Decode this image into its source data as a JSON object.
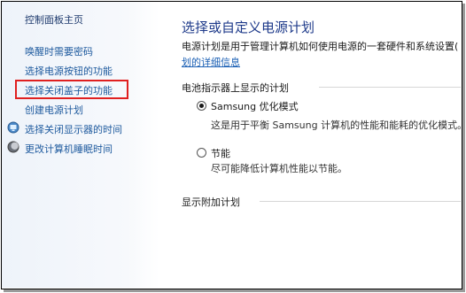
{
  "sidebar": {
    "home": "控制面板主页",
    "tasks": [
      "唤醒时需要密码",
      "选择电源按钮的功能",
      "选择关闭盖子的功能",
      "创建电源计划"
    ],
    "icon_tasks": [
      {
        "label": "选择关闭显示器的时间",
        "icon": "monitor-icon"
      },
      {
        "label": "更改计算机睡眠时间",
        "icon": "moon-icon"
      }
    ],
    "highlight_color": "#e02020"
  },
  "main": {
    "title": "选择或自定义电源计划",
    "description": "电源计划是用于管理计算机如何使用电源的一套硬件和系统设置(",
    "link_fragment": "划的详细信息",
    "battery_group": {
      "title": "电池指示器上显示的计划",
      "plans": [
        {
          "name": "Samsung 优化模式",
          "desc": "这是用于平衡 Samsung 计算机的性能和能耗的优化模式。",
          "selected": true
        },
        {
          "name": "节能",
          "desc": "尽可能降低计算机性能以节能。",
          "selected": false
        }
      ]
    },
    "extra_group": {
      "title": "显示附加计划"
    }
  }
}
